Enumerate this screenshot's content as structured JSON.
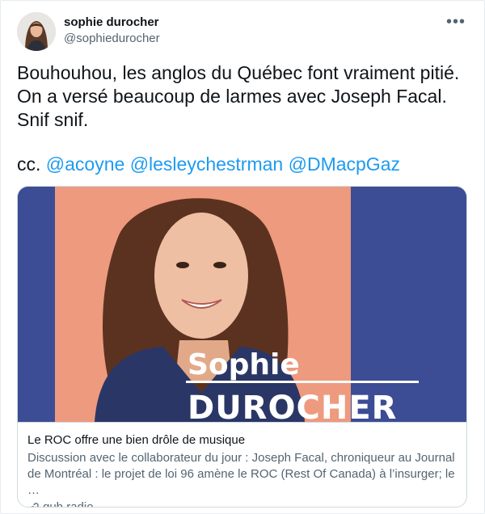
{
  "author": {
    "display_name": "sophie durocher",
    "handle": "@sophiedurocher",
    "avatar_icon": "profile-photo"
  },
  "more_icon": "more-horizontal-icon",
  "tweet": {
    "lines": [
      "Bouhouhou, les anglos du Québec font vraiment pitié.",
      "On a versé beaucoup de larmes avec Joseph Facal.",
      "Snif snif."
    ],
    "cc_prefix": "cc.",
    "mentions": [
      "@acoyne",
      "@lesleychestrman",
      "@DMacpGaz"
    ]
  },
  "card": {
    "image_text_first": "Sophie",
    "image_text_last": "DUROCHER",
    "title": "Le ROC offre une bien drôle de musique",
    "description": "Discussion avec le collaborateur du jour : Joseph Facal, chroniqueur au Journal de Montréal : le projet de loi 96 amène le ROC (Rest Of Canada) à l’insurger; le …",
    "domain": "qub.radio",
    "domain_icon": "link-icon"
  },
  "colors": {
    "mention": "#1d9bf0",
    "card_bg_blue": "#3c4d95",
    "card_bg_salmon": "#ee9a7e",
    "secondary_text": "#536471"
  }
}
